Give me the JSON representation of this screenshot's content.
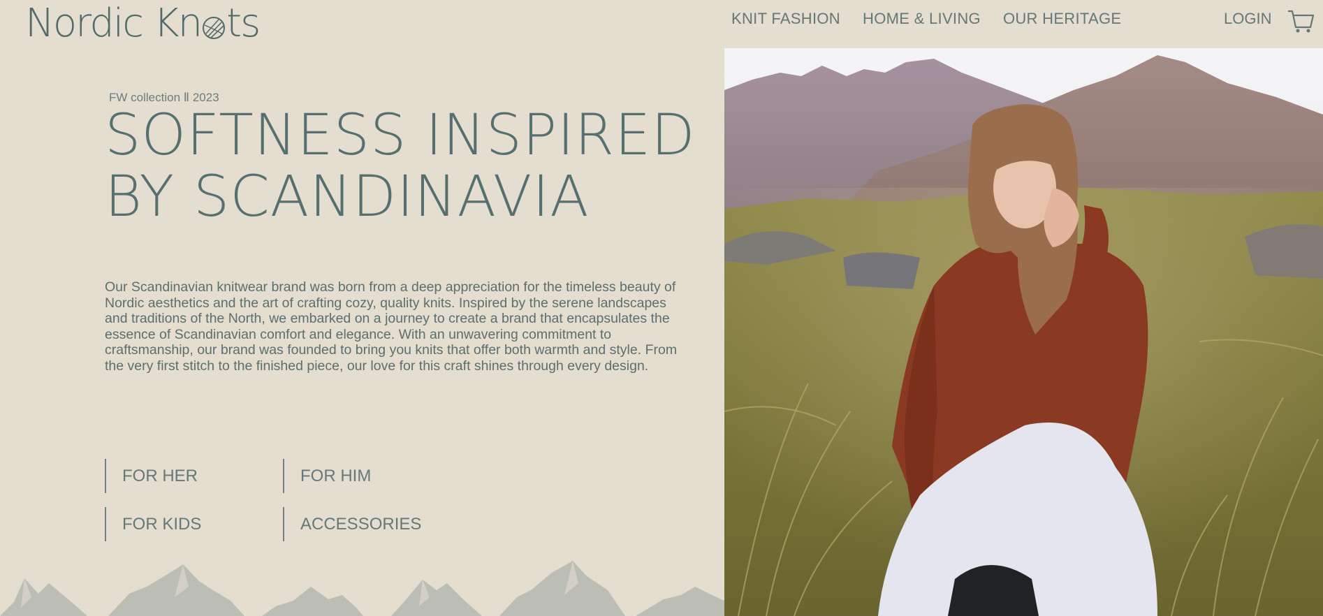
{
  "brand": {
    "name": "Nordic Knots",
    "logo_parts": [
      "Nordic Kn",
      "ts"
    ]
  },
  "nav": {
    "items": [
      {
        "label": "KNIT FASHION"
      },
      {
        "label": "HOME & LIVING"
      },
      {
        "label": "OUR HERITAGE"
      }
    ],
    "login_label": "LOGIN",
    "cart_icon": "shopping-cart-icon"
  },
  "hero": {
    "kicker": "FW collection Ⅱ 2023",
    "headline_line1": "SOFTNESS INSPIRED",
    "headline_line2": "BY SCANDINAVIA",
    "intro": "Our Scandinavian knitwear brand was born from a deep appreciation for the timeless beauty of Nordic aesthetics and the art of crafting cozy, quality knits. Inspired by the serene landscapes and traditions of the North, we embarked on a journey to create a brand that encapsulates the essence of Scandinavian comfort and elegance. With an unwavering commitment to craftsmanship, our brand was founded to bring you knits that offer both warmth and style. From the very first stitch to the finished piece, our love for this craft shines through every design.",
    "image": "woman-in-rust-sweater-sitting-in-grass-field-with-mountains"
  },
  "categories": [
    {
      "label": "FOR HER"
    },
    {
      "label": "FOR HIM"
    },
    {
      "label": "FOR KIDS"
    },
    {
      "label": "ACCESSORIES"
    }
  ],
  "colors": {
    "background": "#e5ddd0",
    "text": "#586b6b",
    "accent": "#56706f",
    "mountain_silhouette": "#bcbeb5"
  }
}
